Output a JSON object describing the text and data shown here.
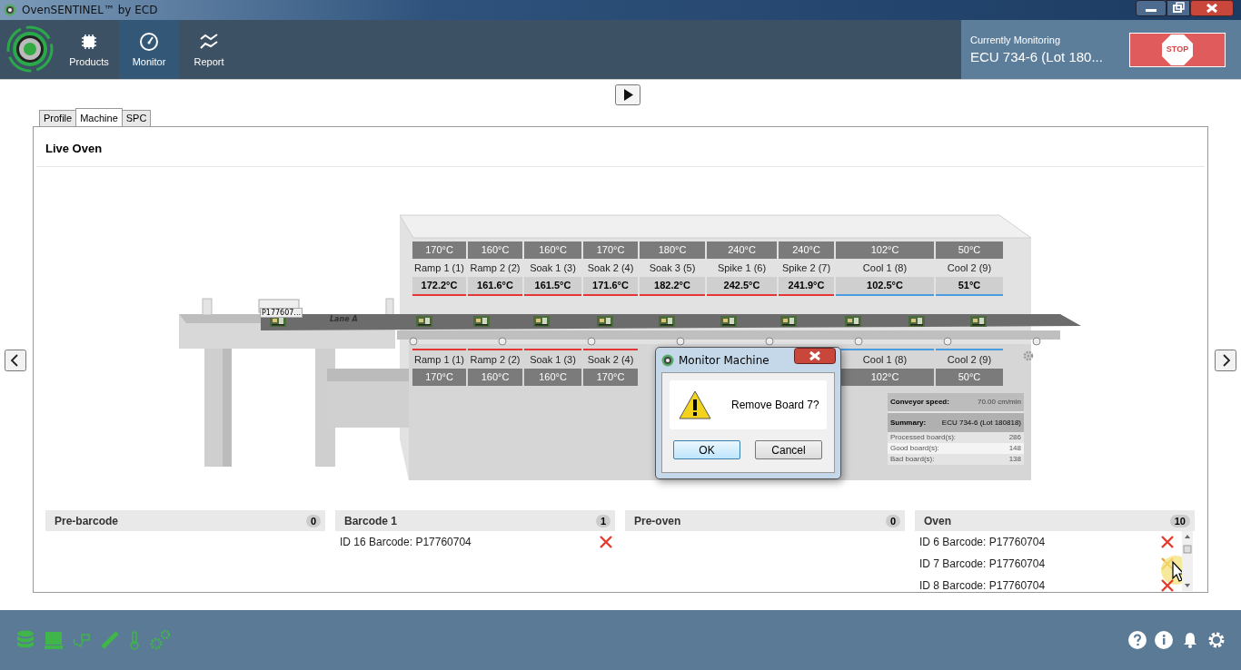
{
  "window": {
    "title": "OvenSENTINEL™ by ECD"
  },
  "nav": [
    {
      "label": "Products",
      "selected": false
    },
    {
      "label": "Monitor",
      "selected": true
    },
    {
      "label": "Report",
      "selected": false
    }
  ],
  "monitoring": {
    "label": "Currently Monitoring",
    "value": "ECU 734-6 (Lot 180...",
    "stop_label": "STOP"
  },
  "tabs": [
    {
      "label": "Profile",
      "selected": false
    },
    {
      "label": "Machine",
      "selected": true
    },
    {
      "label": "SPC",
      "selected": false
    }
  ],
  "panel": {
    "title": "Live Oven"
  },
  "scene": {
    "barcode_tag": "P177607...",
    "lane": "Lane A",
    "upper_zones": [
      {
        "setpoint": "170°C",
        "name": "Ramp 1 (1)",
        "reading": "172.2°C",
        "kind": "heat"
      },
      {
        "setpoint": "160°C",
        "name": "Ramp 2 (2)",
        "reading": "161.6°C",
        "kind": "heat"
      },
      {
        "setpoint": "160°C",
        "name": "Soak 1 (3)",
        "reading": "161.5°C",
        "kind": "heat"
      },
      {
        "setpoint": "170°C",
        "name": "Soak 2 (4)",
        "reading": "171.6°C",
        "kind": "heat"
      },
      {
        "setpoint": "180°C",
        "name": "Soak 3 (5)",
        "reading": "182.2°C",
        "kind": "heat"
      },
      {
        "setpoint": "240°C",
        "name": "Spike 1 (6)",
        "reading": "242.5°C",
        "kind": "heat"
      },
      {
        "setpoint": "240°C",
        "name": "Spike 2 (7)",
        "reading": "241.9°C",
        "kind": "heat"
      },
      {
        "setpoint": "102°C",
        "name": "Cool 1 (8)",
        "reading": "102.5°C",
        "kind": "cool"
      },
      {
        "setpoint": "50°C",
        "name": "Cool 2 (9)",
        "reading": "51°C",
        "kind": "cool"
      }
    ],
    "lower_zones_left": [
      {
        "name": "Ramp 1 (1)",
        "setpoint": "170°C",
        "kind": "heat"
      },
      {
        "name": "Ramp 2 (2)",
        "setpoint": "160°C",
        "kind": "heat"
      },
      {
        "name": "Soak 1 (3)",
        "setpoint": "160°C",
        "kind": "heat"
      },
      {
        "name": "Soak 2 (4)",
        "setpoint": "170°C",
        "kind": "heat"
      }
    ],
    "lower_zones_right": [
      {
        "name": "Cool 1 (8)",
        "setpoint": "102°C",
        "kind": "cool"
      },
      {
        "name": "Cool 2 (9)",
        "setpoint": "50°C",
        "kind": "cool"
      }
    ],
    "conveyor_speed": {
      "label": "Conveyor speed:",
      "value": "70.00 cm/min"
    },
    "summary": {
      "label": "Summary:",
      "value": "ECU 734-6 (Lot 180818)"
    },
    "stats": [
      {
        "label": "Processed board(s):",
        "value": "286"
      },
      {
        "label": "Good board(s):",
        "value": "148"
      },
      {
        "label": "Bad board(s):",
        "value": "138"
      }
    ]
  },
  "queues": [
    {
      "title": "Pre-barcode",
      "count": "0"
    },
    {
      "title": "Barcode 1",
      "count": "1",
      "items": [
        {
          "text": "ID 16 Barcode: P17760704",
          "hovered": false
        }
      ]
    },
    {
      "title": "Pre-oven",
      "count": "0"
    },
    {
      "title": "Oven",
      "count": "10",
      "items": [
        {
          "text": "ID 6 Barcode: P17760704",
          "hovered": false
        },
        {
          "text": "ID 7 Barcode: P17760704",
          "hovered": true
        },
        {
          "text": "ID 8 Barcode: P17760704",
          "hovered": false
        }
      ]
    }
  ],
  "dialog": {
    "title": "Monitor Machine",
    "message": "Remove Board 7?",
    "buttons": [
      {
        "label": "OK",
        "selected": true
      },
      {
        "label": "Cancel",
        "selected": false
      }
    ]
  }
}
